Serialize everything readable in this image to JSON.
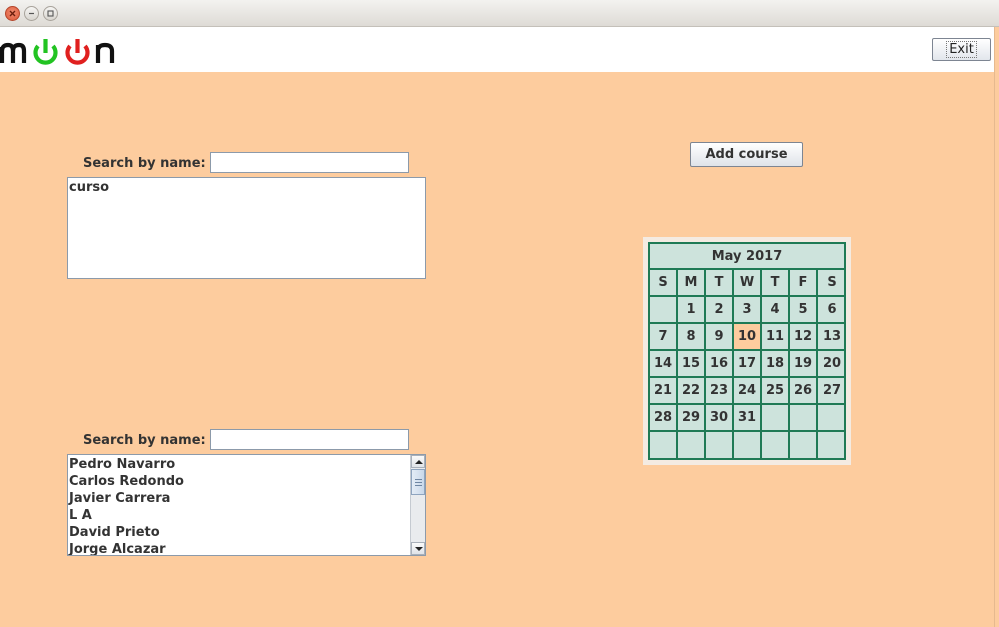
{
  "header": {
    "logo_text": "moon",
    "exit_label": "Exit"
  },
  "courses": {
    "search_label": "Search by name:",
    "search_value": "",
    "items": [
      "curso"
    ]
  },
  "users": {
    "search_label": "Search by name:",
    "search_value": "",
    "items": [
      "Pedro Navarro",
      "Carlos Redondo",
      "Javier Carrera",
      "L A",
      "David Prieto",
      "Jorge Alcazar"
    ]
  },
  "add_course_label": "Add course",
  "calendar": {
    "title": "May 2017",
    "weekdays": [
      "S",
      "M",
      "T",
      "W",
      "T",
      "F",
      "S"
    ],
    "weeks": [
      [
        "",
        "1",
        "2",
        "3",
        "4",
        "5",
        "6"
      ],
      [
        "7",
        "8",
        "9",
        "10",
        "11",
        "12",
        "13"
      ],
      [
        "14",
        "15",
        "16",
        "17",
        "18",
        "19",
        "20"
      ],
      [
        "21",
        "22",
        "23",
        "24",
        "25",
        "26",
        "27"
      ],
      [
        "28",
        "29",
        "30",
        "31",
        "",
        "",
        ""
      ],
      [
        "",
        "",
        "",
        "",
        "",
        "",
        ""
      ]
    ],
    "highlighted_day": "10",
    "colors": {
      "grid": "#1f7a55",
      "cell": "#cde3dc",
      "highlight": "#fdcc9e"
    }
  },
  "colors": {
    "background": "#fdcc9e",
    "logo_green": "#22c322",
    "logo_red": "#e0201f"
  }
}
